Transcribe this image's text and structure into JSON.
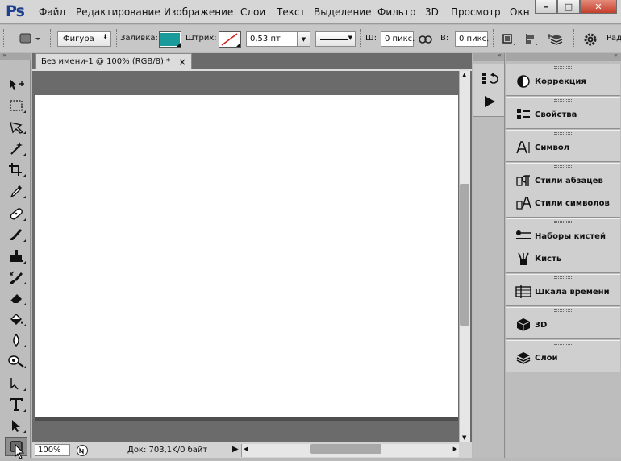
{
  "app": {
    "logo": "Ps"
  },
  "menubar": {
    "items": [
      "Файл",
      "Редактирование",
      "Изображение",
      "Слои",
      "Текст",
      "Выделение",
      "Фильтр",
      "3D",
      "Просмотр",
      "Окн"
    ]
  },
  "window_controls": {
    "minimize": "–",
    "maximize": "□",
    "close": "✕"
  },
  "options": {
    "shape_mode": "Фигура",
    "fill_label": "Заливка:",
    "fill_color": "#1a9a9a",
    "stroke_label": "Штрих:",
    "stroke_width": "0,53 пт",
    "width_label": "Ш:",
    "width_value": "0 пикс.",
    "height_label": "В:",
    "height_value": "0 пикс.",
    "overflow_label": "Рад"
  },
  "document": {
    "tab_title": "Без имени-1 @ 100% (RGB/8) *",
    "close_glyph": "×",
    "zoom": "100%",
    "doc_info": "Док: 703,1K/0 байт"
  },
  "tools": [
    "move-icon",
    "rect-marquee-icon",
    "lasso-icon",
    "magic-wand-icon",
    "crop-icon",
    "eyedropper-icon",
    "healing-brush-icon",
    "brush-icon",
    "stamp-icon",
    "history-brush-icon",
    "eraser-icon",
    "paint-bucket-icon",
    "blur-icon",
    "dodge-icon",
    "pen-icon",
    "type-icon",
    "path-select-icon",
    "rectangle-shape-icon"
  ],
  "panels": {
    "groups": [
      {
        "items": [
          {
            "label": "Коррекция",
            "icon": "adjustments-icon"
          }
        ]
      },
      {
        "items": [
          {
            "label": "Свойства",
            "icon": "properties-icon"
          }
        ]
      },
      {
        "items": [
          {
            "label": "Символ",
            "icon": "character-icon"
          }
        ]
      },
      {
        "items": [
          {
            "label": "Стили абзацев",
            "icon": "paragraph-styles-icon"
          },
          {
            "label": "Стили символов",
            "icon": "character-styles-icon"
          }
        ]
      },
      {
        "items": [
          {
            "label": "Наборы кистей",
            "icon": "brush-presets-icon"
          },
          {
            "label": "Кисть",
            "icon": "brush-panel-icon"
          }
        ]
      },
      {
        "items": [
          {
            "label": "Шкала времени",
            "icon": "timeline-icon"
          }
        ]
      },
      {
        "items": [
          {
            "label": "3D",
            "icon": "3d-icon"
          }
        ]
      },
      {
        "items": [
          {
            "label": "Слои",
            "icon": "layers-icon"
          }
        ]
      }
    ]
  }
}
